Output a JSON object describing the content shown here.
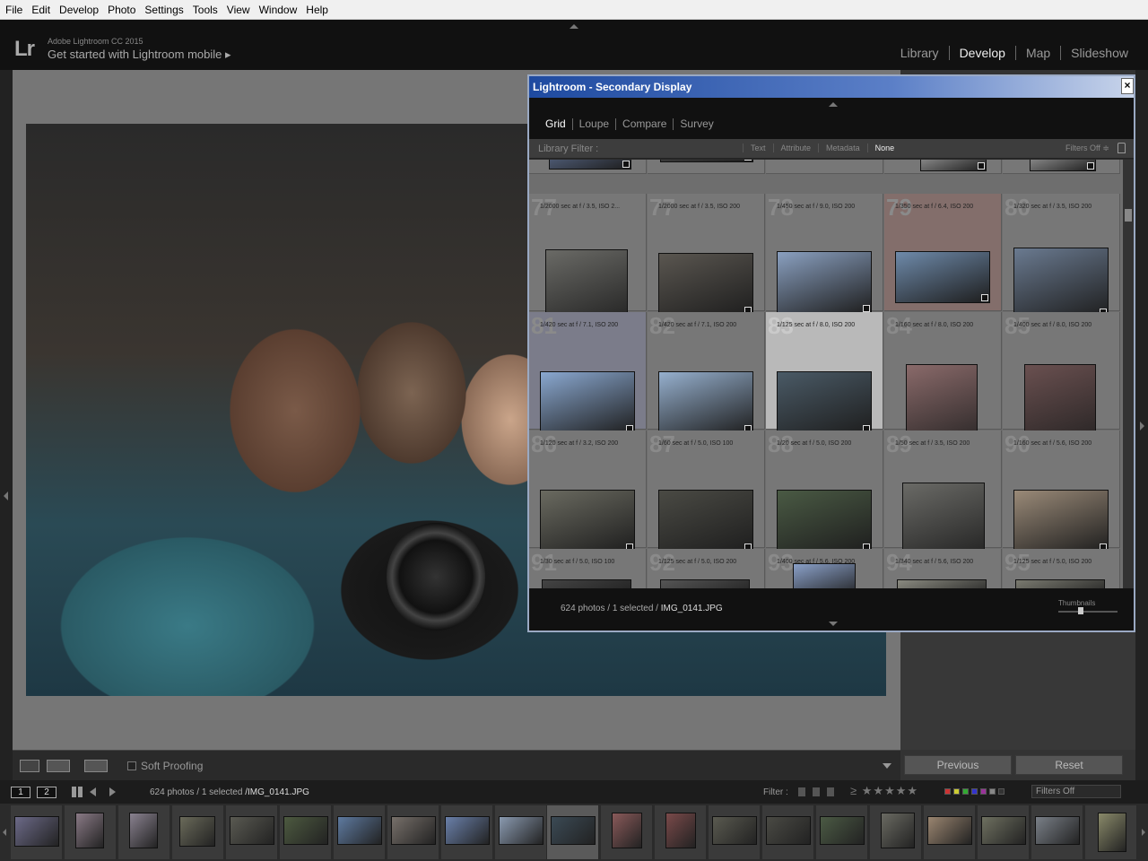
{
  "menu": [
    "File",
    "Edit",
    "Develop",
    "Photo",
    "Settings",
    "Tools",
    "View",
    "Window",
    "Help"
  ],
  "identity": {
    "logo": "Lr",
    "version": "Adobe Lightroom CC 2015",
    "mobile": "Get started with Lightroom mobile ▸"
  },
  "modules": [
    {
      "label": "Library",
      "active": false
    },
    {
      "label": "Develop",
      "active": true
    },
    {
      "label": "Map",
      "active": false
    },
    {
      "label": "Slideshow",
      "active": false
    }
  ],
  "toolbar": {
    "soft_proofing": "Soft Proofing"
  },
  "panel": {
    "previous": "Previous",
    "reset": "Reset"
  },
  "filmstrip": {
    "view1": "1",
    "view2": "2",
    "status_prefix": "624 photos /",
    "selected": "1 selected",
    "filename": "/IMG_0141.JPG",
    "filter_label": "Filter :",
    "rating_prefix": "≥",
    "stars": "★★★★★",
    "filters_off": "Filters Off"
  },
  "secondary": {
    "title": "Lightroom - Secondary Display",
    "close": "×",
    "tabs": [
      {
        "label": "Grid",
        "active": true
      },
      {
        "label": "Loupe",
        "active": false
      },
      {
        "label": "Compare",
        "active": false
      },
      {
        "label": "Survey",
        "active": false
      }
    ],
    "filter_label": "Library Filter :",
    "filter_options": [
      {
        "label": "Text",
        "active": false
      },
      {
        "label": "Attribute",
        "active": false
      },
      {
        "label": "Metadata",
        "active": false
      },
      {
        "label": "None",
        "active": true
      }
    ],
    "filters_off": "Filters Off ≑",
    "status_prefix": "624 photos / 1 selected /",
    "filename": "IMG_0141.JPG",
    "thumbnails_label": "Thumbnails",
    "grid": [
      {
        "num": "",
        "meta": ""
      },
      {
        "num": "",
        "meta": ""
      },
      {
        "num": "",
        "meta": ""
      },
      {
        "num": "",
        "meta": ""
      },
      {
        "num": "",
        "meta": ""
      },
      {
        "num": "77",
        "meta": "1/2000 sec at f / 3.5, ISO 2..."
      },
      {
        "num": "77",
        "meta": "1/2000 sec at f / 3.5, ISO 200"
      },
      {
        "num": "78",
        "meta": "1/450 sec at f / 9.0, ISO 200"
      },
      {
        "num": "79",
        "meta": "1/350 sec at f / 6.4, ISO 200"
      },
      {
        "num": "80",
        "meta": "1/320 sec at f / 3.5, ISO 200"
      },
      {
        "num": "81",
        "meta": "1/420 sec at f / 7.1, ISO 200"
      },
      {
        "num": "82",
        "meta": "1/420 sec at f / 7.1, ISO 200"
      },
      {
        "num": "83",
        "meta": "1/125 sec at f / 8.0, ISO 200"
      },
      {
        "num": "84",
        "meta": "1/160 sec at f / 8.0, ISO 200"
      },
      {
        "num": "85",
        "meta": "1/400 sec at f / 8.0, ISO 200"
      },
      {
        "num": "86",
        "meta": "1/120 sec at f / 3.2, ISO 200"
      },
      {
        "num": "87",
        "meta": "1/60 sec at f / 5.0, ISO 100"
      },
      {
        "num": "88",
        "meta": "1/20 sec at f / 5.0, ISO 200"
      },
      {
        "num": "89",
        "meta": "1/50 sec at f / 3.5, ISO 200"
      },
      {
        "num": "90",
        "meta": "1/160 sec at f / 5.6, ISO 200"
      },
      {
        "num": "91",
        "meta": "1/30 sec at f / 5.0, ISO 100"
      },
      {
        "num": "92",
        "meta": "1/125 sec at f / 5.0, ISO 200"
      },
      {
        "num": "93",
        "meta": "1/400 sec at f / 5.6, ISO 200"
      },
      {
        "num": "94",
        "meta": "1/340 sec at f / 5.6, ISO 200"
      },
      {
        "num": "95",
        "meta": "1/125 sec at f / 5.0, ISO 200"
      }
    ]
  }
}
